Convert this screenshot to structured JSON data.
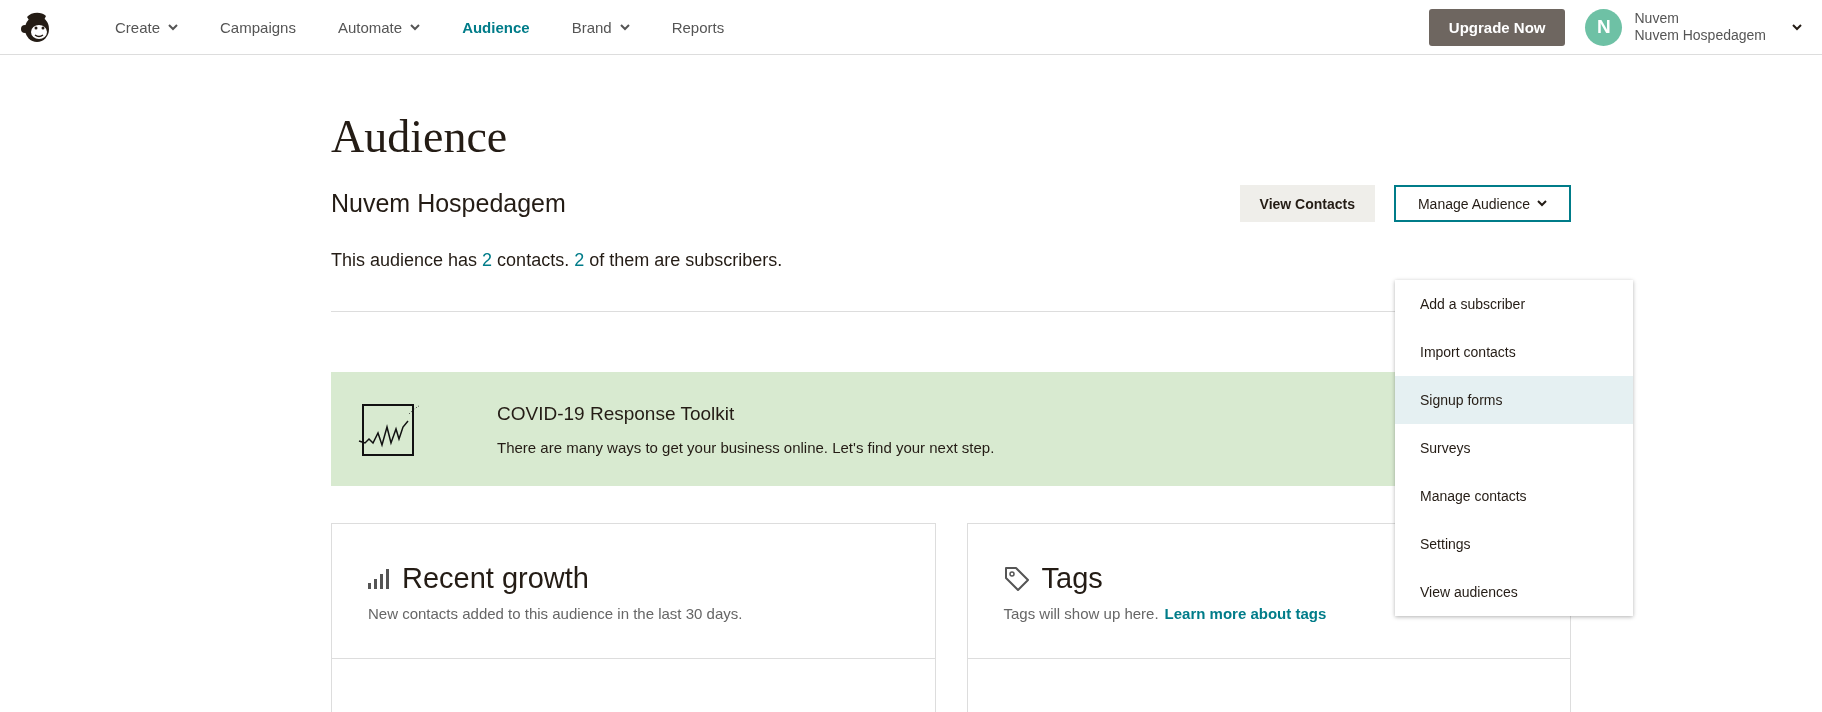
{
  "nav": {
    "items": [
      {
        "label": "Create",
        "has_menu": true,
        "selected": false
      },
      {
        "label": "Campaigns",
        "has_menu": false,
        "selected": false
      },
      {
        "label": "Automate",
        "has_menu": true,
        "selected": false
      },
      {
        "label": "Audience",
        "has_menu": false,
        "selected": true
      },
      {
        "label": "Brand",
        "has_menu": true,
        "selected": false
      },
      {
        "label": "Reports",
        "has_menu": false,
        "selected": false
      }
    ],
    "upgrade_button": "Upgrade Now",
    "account": {
      "initial": "N",
      "name": "Nuvem",
      "org": "Nuvem Hospedagem"
    }
  },
  "page": {
    "title": "Audience",
    "audience_name": "Nuvem Hospedagem",
    "summary": "This audience has **2** contacts. **2** of them are subscribers.",
    "view_contacts_button": "View Contacts",
    "manage_button": {
      "label": "Manage Audience",
      "expanded": true
    },
    "menu": [
      {
        "label": "Add a subscriber",
        "selected": false
      },
      {
        "label": "Import contacts",
        "selected": false
      },
      {
        "label": "Signup forms",
        "selected": true
      },
      {
        "label": "Surveys",
        "selected": false
      },
      {
        "label": "Manage contacts",
        "selected": false
      },
      {
        "label": "Settings",
        "selected": false
      },
      {
        "label": "View audiences",
        "selected": false
      }
    ]
  },
  "banner": {
    "title": "COVID-19 Response Toolkit",
    "text": "There are many ways to get your business online. Let's find your next step."
  },
  "cards": [
    {
      "kind": "growth",
      "title": "Recent growth",
      "text": "New contacts added to this audience in the last 30 days."
    },
    {
      "kind": "tags",
      "title": "Tags",
      "text": "Tags will show up here.",
      "link": "Learn more about tags"
    }
  ]
}
